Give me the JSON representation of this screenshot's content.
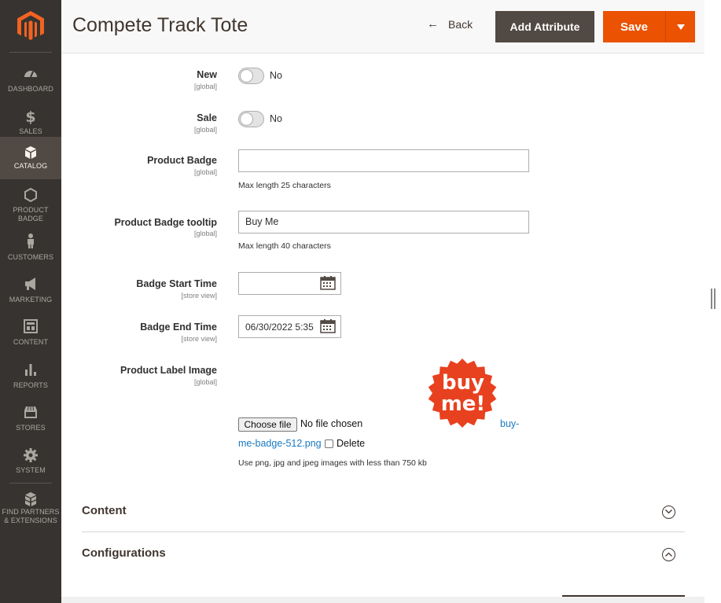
{
  "header": {
    "title": "Compete Track Tote",
    "back_label": "Back",
    "add_attribute_label": "Add Attribute",
    "save_label": "Save"
  },
  "sidebar": {
    "items": [
      {
        "label": "DASHBOARD",
        "icon": "dashboard-icon"
      },
      {
        "label": "SALES",
        "icon": "dollar-icon"
      },
      {
        "label": "CATALOG",
        "icon": "box-icon",
        "active": true
      },
      {
        "label": "PRODUCT BADGE",
        "icon": "hexagon-icon"
      },
      {
        "label": "CUSTOMERS",
        "icon": "person-icon"
      },
      {
        "label": "MARKETING",
        "icon": "megaphone-icon"
      },
      {
        "label": "CONTENT",
        "icon": "layout-icon"
      },
      {
        "label": "REPORTS",
        "icon": "bar-chart-icon"
      },
      {
        "label": "STORES",
        "icon": "store-icon"
      },
      {
        "label": "SYSTEM",
        "icon": "gear-icon"
      },
      {
        "label": "FIND PARTNERS & EXTENSIONS",
        "icon": "blocks-icon"
      }
    ]
  },
  "form": {
    "new": {
      "label": "New",
      "scope": "[global]",
      "value": "No",
      "enabled": false
    },
    "sale": {
      "label": "Sale",
      "scope": "[global]",
      "value": "No",
      "enabled": false
    },
    "product_badge": {
      "label": "Product Badge",
      "scope": "[global]",
      "value": "",
      "note": "Max length 25 characters"
    },
    "product_badge_tooltip": {
      "label": "Product Badge tooltip",
      "scope": "[global]",
      "value": "Buy Me",
      "note": "Max length 40 characters"
    },
    "badge_start_time": {
      "label": "Badge Start Time",
      "scope": "[store view]",
      "value": ""
    },
    "badge_end_time": {
      "label": "Badge End Time",
      "scope": "[store view]",
      "value": "06/30/2022 5:35"
    },
    "product_label_image": {
      "label": "Product Label Image",
      "scope": "[global]",
      "badge_text_line1": "buy",
      "badge_text_line2": "me!",
      "choose_file_label": "Choose file",
      "no_file_text": "No file chosen",
      "file_name_part1": "buy-",
      "file_name_part2": "me-badge-512.png",
      "delete_label": "Delete",
      "note": "Use png, jpg and jpeg images with less than 750 kb"
    }
  },
  "sections": {
    "content": "Content",
    "configurations": "Configurations"
  },
  "colors": {
    "accent": "#eb5202",
    "sidebar_bg": "#373330",
    "button_dark": "#514943",
    "link": "#1979c3",
    "badge_red": "#e8411f"
  }
}
